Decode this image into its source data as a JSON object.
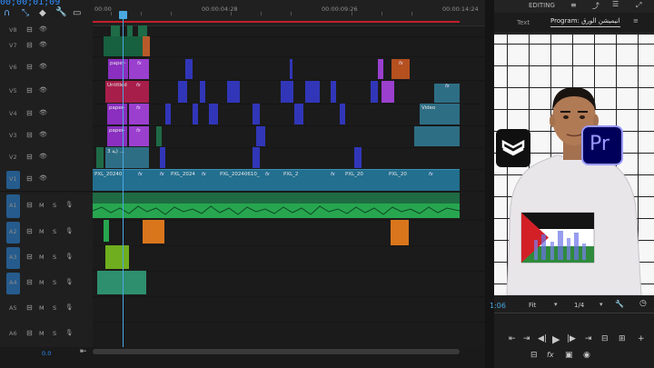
{
  "timecode": "00;00;01;09",
  "ruler": {
    "marks": [
      "00:00",
      "00:00:04:28",
      "00:00:09:26",
      "00:00:14:24"
    ]
  },
  "tracks": [
    {
      "name": "V8"
    },
    {
      "name": "V7"
    },
    {
      "name": "V6"
    },
    {
      "name": "V5"
    },
    {
      "name": "V4"
    },
    {
      "name": "V3"
    },
    {
      "name": "V2"
    },
    {
      "name": "V1"
    },
    {
      "name": "A1"
    },
    {
      "name": "A2"
    },
    {
      "name": "A3"
    },
    {
      "name": "A4"
    },
    {
      "name": "A5"
    },
    {
      "name": "A6"
    }
  ],
  "track_icons": {
    "mute": "M",
    "solo": "S"
  },
  "clips": {
    "paper1": "paper-",
    "untitled": "Untitled",
    "paper2": "paper-",
    "paper3": "paper-",
    "arabic_v2": "ية 3) ...",
    "video_v4": "Video",
    "fx": "fx",
    "pxl1": "PXL_20240",
    "pxl2": "PXL_2024",
    "pxl3": "PXL_20240610_",
    "pxl4": "PXL_2",
    "pxl5": "PXL_20",
    "pxl6": "PXL_20"
  },
  "bottom": {
    "value": "0.0"
  },
  "program": {
    "workspace": "EDITING",
    "tab_text": "Text",
    "tab_program": "Program: انيميشن الورق",
    "timecode": "1:06",
    "fit": "Fit",
    "ratio": "1/4"
  },
  "logos": {
    "capcut": "capcut-logo",
    "premiere": "Pr"
  },
  "colors": {
    "accent": "#2f8fff",
    "playhead": "#4aa8e0",
    "red_line": "#c21f2a",
    "clip_blue": "#3136b8",
    "clip_purple": "#9b3fcf",
    "clip_green": "#1f7a4c",
    "clip_teal": "#2e6e85",
    "audio_green": "#27a64f"
  }
}
